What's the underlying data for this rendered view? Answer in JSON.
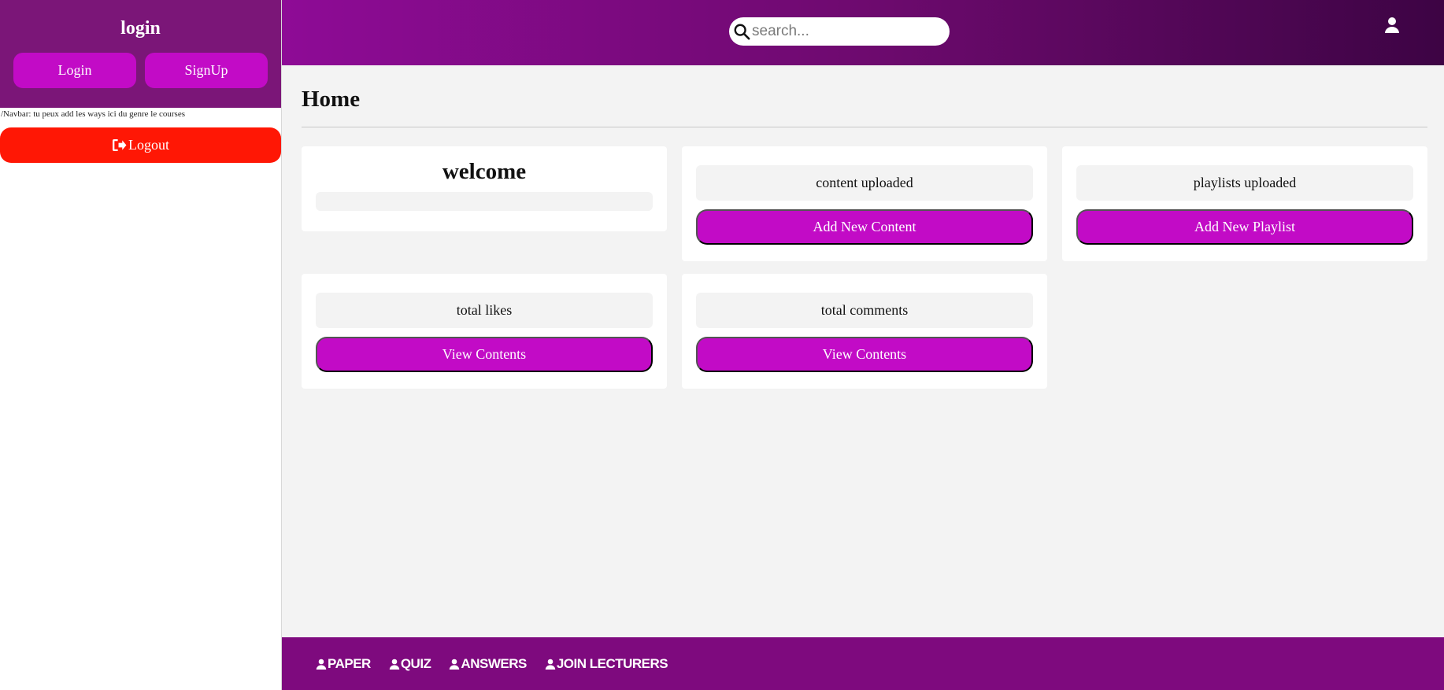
{
  "sidebar": {
    "title": "login",
    "login_label": "Login",
    "signup_label": "SignUp",
    "note": "/Navbar: tu peux add les ways ici du genre le courses",
    "logout_label": "Logout"
  },
  "header": {
    "search_placeholder": "search...",
    "user_icon": "user-icon"
  },
  "main": {
    "page_title": "Home",
    "cards": {
      "welcome": {
        "title": "welcome"
      },
      "content": {
        "stat": "content uploaded",
        "button": "Add New Content"
      },
      "playlists": {
        "stat": "playlists uploaded",
        "button": "Add New Playlist"
      },
      "likes": {
        "stat": "total likes",
        "button": "View Contents"
      },
      "comments": {
        "stat": "total comments",
        "button": "View Contents"
      }
    }
  },
  "footer": {
    "links": [
      "PAPER",
      "QUIZ",
      "ANSWERS",
      "JOIN LECTURERS"
    ]
  },
  "colors": {
    "sidebar_header": "#7b1678",
    "accent": "#c20bc6",
    "logout": "#ff1705",
    "footer": "#7e0a7e"
  }
}
